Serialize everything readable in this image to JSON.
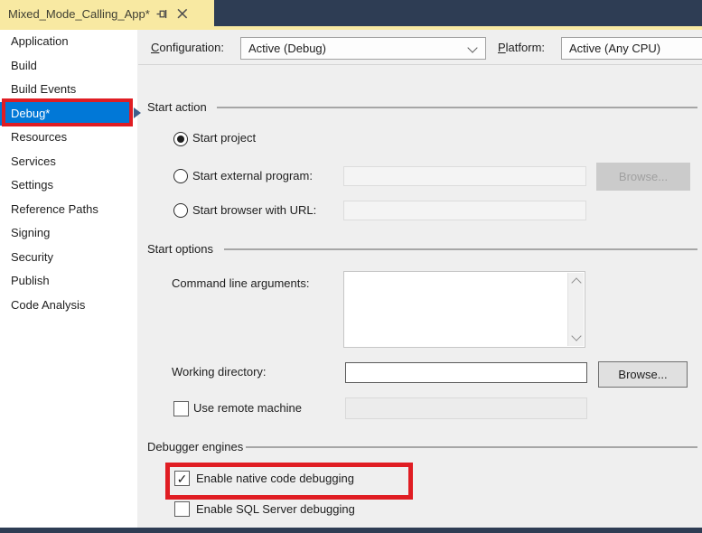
{
  "tab": {
    "title": "Mixed_Mode_Calling_App*"
  },
  "sidebar": {
    "items": [
      {
        "label": "Application"
      },
      {
        "label": "Build"
      },
      {
        "label": "Build Events"
      },
      {
        "label": "Debug*",
        "selected": true,
        "annotated": true
      },
      {
        "label": "Resources"
      },
      {
        "label": "Services"
      },
      {
        "label": "Settings"
      },
      {
        "label": "Reference Paths"
      },
      {
        "label": "Signing"
      },
      {
        "label": "Security"
      },
      {
        "label": "Publish"
      },
      {
        "label": "Code Analysis"
      }
    ]
  },
  "toolbar": {
    "configuration_label": "Configuration:",
    "configuration_value": "Active (Debug)",
    "platform_label": "Platform:",
    "platform_value": "Active (Any CPU)"
  },
  "start_action": {
    "title": "Start action",
    "radio_start_project": "Start project",
    "radio_external": "Start external program:",
    "radio_browser": "Start browser with URL:",
    "external_value": "",
    "browser_value": "",
    "browse_label": "Browse..."
  },
  "start_options": {
    "title": "Start options",
    "cmd_label": "Command line arguments:",
    "cmd_value": "",
    "workdir_label": "Working directory:",
    "workdir_value": "",
    "browse_label": "Browse...",
    "remote_label": "Use remote machine",
    "remote_value": ""
  },
  "debugger_engines": {
    "title": "Debugger engines",
    "native_label": "Enable native code debugging",
    "native_check_glyph": "✓",
    "sql_label": "Enable SQL Server debugging"
  },
  "colors": {
    "accent_blue": "#0178d7",
    "annotation_red": "#e01d23",
    "tab_yellow": "#f8e9a2",
    "titlebar_dark": "#2e3d54"
  }
}
